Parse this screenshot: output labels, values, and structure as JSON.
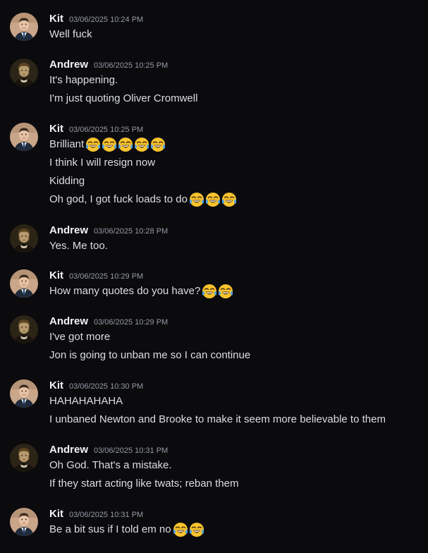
{
  "emoji_name": "face-with-tears-of-joy",
  "messages": [
    {
      "user": "Kit",
      "timestamp": "03/06/2025 10:24 PM",
      "lines": [
        {
          "text": "Well fuck",
          "emoji_count": 0
        }
      ]
    },
    {
      "user": "Andrew",
      "timestamp": "03/06/2025 10:25 PM",
      "lines": [
        {
          "text": "It's happening.",
          "emoji_count": 0
        },
        {
          "text": "I'm just quoting Oliver Cromwell",
          "emoji_count": 0
        }
      ]
    },
    {
      "user": "Kit",
      "timestamp": "03/06/2025 10:25 PM",
      "lines": [
        {
          "text": "Brilliant",
          "emoji_count": 5
        },
        {
          "text": "I think I will resign now",
          "emoji_count": 0
        },
        {
          "text": "Kidding",
          "emoji_count": 0
        },
        {
          "text": "Oh god, I got fuck loads to do",
          "emoji_count": 3
        }
      ]
    },
    {
      "user": "Andrew",
      "timestamp": "03/06/2025 10:28 PM",
      "lines": [
        {
          "text": "Yes. Me too.",
          "emoji_count": 0
        }
      ]
    },
    {
      "user": "Kit",
      "timestamp": "03/06/2025 10:29 PM",
      "lines": [
        {
          "text": "How many quotes do you have?",
          "emoji_count": 2
        }
      ]
    },
    {
      "user": "Andrew",
      "timestamp": "03/06/2025 10:29 PM",
      "lines": [
        {
          "text": "I've got more",
          "emoji_count": 0
        },
        {
          "text": "Jon is going to unban me so I can continue",
          "emoji_count": 0
        }
      ]
    },
    {
      "user": "Kit",
      "timestamp": "03/06/2025 10:30 PM",
      "lines": [
        {
          "text": "HAHAHAHAHA",
          "emoji_count": 0
        },
        {
          "text": "I unbaned Newton and Brooke to make it seem more believable to them",
          "emoji_count": 0
        }
      ]
    },
    {
      "user": "Andrew",
      "timestamp": "03/06/2025 10:31 PM",
      "lines": [
        {
          "text": "Oh God. That's a mistake.",
          "emoji_count": 0
        },
        {
          "text": "If they start acting like twats; reban them",
          "emoji_count": 0
        }
      ]
    },
    {
      "user": "Kit",
      "timestamp": "03/06/2025 10:31 PM",
      "lines": [
        {
          "text": "Be a bit sus if I told em no",
          "emoji_count": 2
        }
      ]
    }
  ]
}
